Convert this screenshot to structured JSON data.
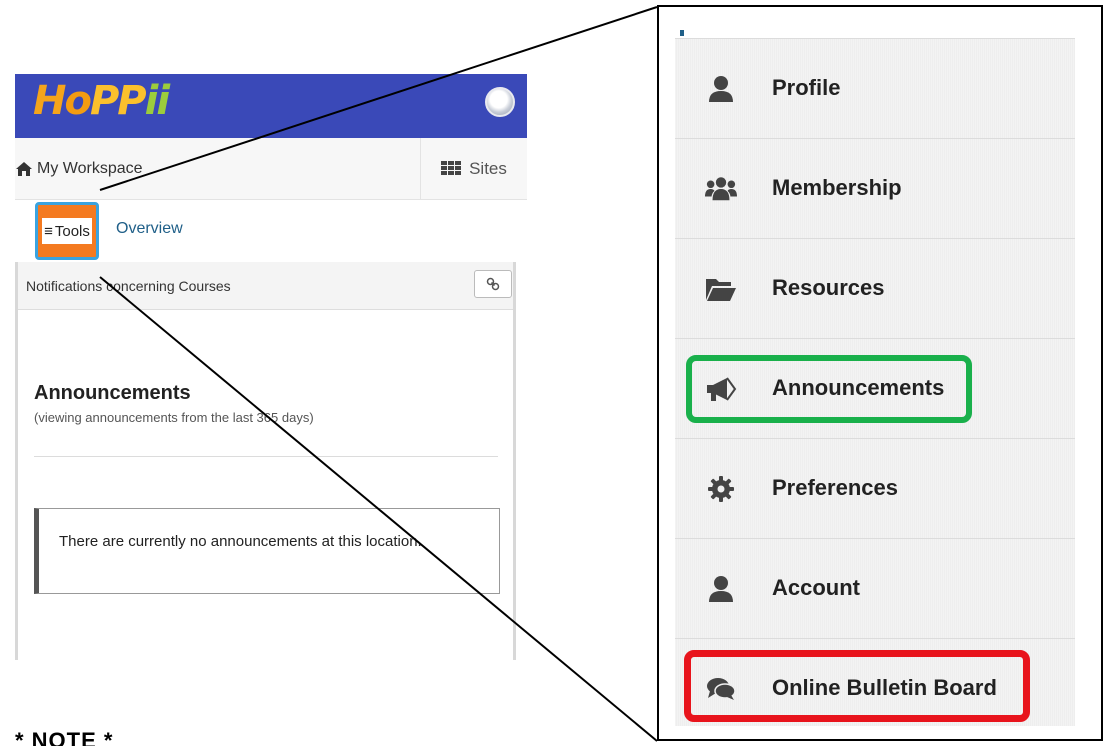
{
  "phone": {
    "logo": {
      "text_parts": [
        "H",
        "o",
        "PP",
        "ii"
      ]
    },
    "workspace": {
      "home_label": "My Workspace",
      "sites_label": "Sites"
    },
    "tabs": {
      "tools_label": "Tools",
      "overview_label": "Overview"
    },
    "card": {
      "header": "Notifications concerning Courses",
      "link_icon": "link-icon",
      "title": "Announcements",
      "subtitle": "(viewing announcements from the last 365 days)",
      "empty_message": "There are currently no announcements at this location."
    }
  },
  "menu": {
    "items": [
      {
        "label": "Profile",
        "icon": "user-icon"
      },
      {
        "label": "Membership",
        "icon": "users-icon"
      },
      {
        "label": "Resources",
        "icon": "folder-open-icon"
      },
      {
        "label": "Announcements",
        "icon": "bullhorn-icon"
      },
      {
        "label": "Preferences",
        "icon": "gear-icon"
      },
      {
        "label": "Account",
        "icon": "user-icon"
      },
      {
        "label": "Online Bulletin Board",
        "icon": "comments-icon"
      }
    ]
  },
  "note": {
    "text": "* NOTE *"
  },
  "colors": {
    "topbar": "#3a49b8",
    "tools_highlight": "#f47a20",
    "tools_border": "#3aa3e0",
    "highlight_green": "#19b04b",
    "highlight_red": "#e8141c",
    "link": "#1f5f88"
  }
}
